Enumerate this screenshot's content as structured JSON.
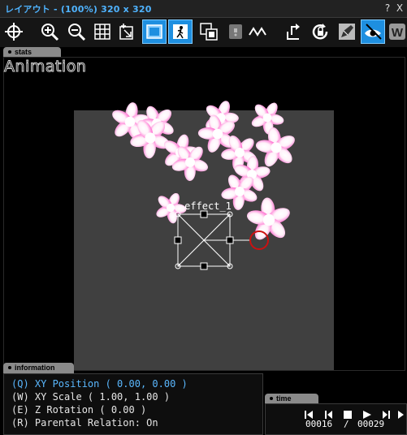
{
  "window": {
    "title": "レイアウト - (100%) 320 x 320",
    "help_label": "?",
    "close_label": "X"
  },
  "toolbar": {
    "tools": [
      {
        "name": "crosshair-icon",
        "active": false
      },
      {
        "name": "zoom-in-icon",
        "active": false
      },
      {
        "name": "zoom-out-icon",
        "active": false
      },
      {
        "name": "grid-icon",
        "active": false
      },
      {
        "name": "anchor-icon",
        "active": false
      },
      {
        "name": "frame-icon",
        "active": true
      },
      {
        "name": "figure-icon",
        "active": true
      },
      {
        "name": "layer-icon",
        "active": false
      },
      {
        "name": "lock-gray-icon",
        "active": false
      },
      {
        "name": "curve-icon",
        "active": false
      },
      {
        "name": "export-icon",
        "active": false
      },
      {
        "name": "rotate-lock-icon",
        "active": false
      },
      {
        "name": "pen-icon",
        "active": false
      },
      {
        "name": "eye-icon",
        "active": true
      },
      {
        "name": "wide-icon",
        "active": false
      }
    ]
  },
  "stats_tab": {
    "label": "stats"
  },
  "heading": "Animation",
  "canvas": {
    "object_label": "effect_1",
    "colors": {
      "background": "#404040",
      "selection": "#ffffff",
      "rotation_ring": "#cc1111",
      "petal": "#ff66cc"
    }
  },
  "information": {
    "tab_label": "information",
    "lines": [
      {
        "text": "(Q) XY Position ( 0.00, 0.00 )",
        "active": true
      },
      {
        "text": "(W) XY Scale ( 1.00, 1.00 )",
        "active": false
      },
      {
        "text": "(E) Z Rotation ( 0.00 )",
        "active": false
      },
      {
        "text": "(R) Parental Relation: On",
        "active": false
      }
    ]
  },
  "time": {
    "tab_label": "time",
    "current_frame": "00016",
    "separator": "/",
    "total_frames": "00029"
  },
  "colors": {
    "accent": "#1e8fe0",
    "title": "#4fb3ff",
    "info_active": "#5ab8ff"
  }
}
